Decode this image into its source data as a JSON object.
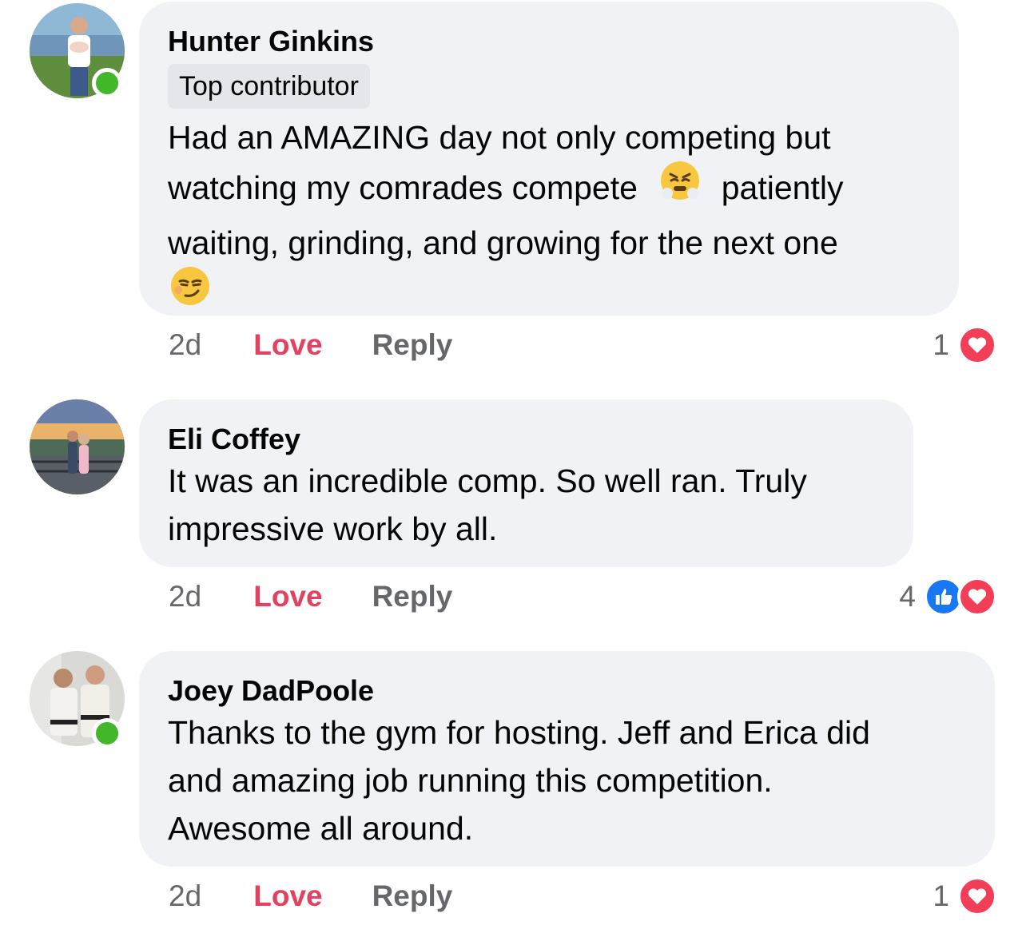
{
  "comments": [
    {
      "author": "Hunter Ginkins",
      "badge": "Top contributor",
      "text_lines": [
        "Had an AMAZING day not only competing but",
        "watching my comrades compete",
        "patiently",
        "waiting, grinding, and growing for the next one"
      ],
      "emojis": [
        "steam-from-nose-emoji",
        "smirking-face-emoji"
      ],
      "online": true,
      "time": "2d",
      "love_label": "Love",
      "reply_label": "Reply",
      "reaction_count": "1",
      "reactions": [
        "love"
      ]
    },
    {
      "author": "Eli Coffey",
      "text_lines": [
        "It was an incredible comp. So well ran. Truly",
        "impressive work by all."
      ],
      "online": false,
      "time": "2d",
      "love_label": "Love",
      "reply_label": "Reply",
      "reaction_count": "4",
      "reactions": [
        "like",
        "love"
      ]
    },
    {
      "author": "Joey DadPoole",
      "text_lines": [
        "Thanks to the gym for hosting. Jeff and Erica did",
        "and amazing job running this competition.",
        "Awesome all around."
      ],
      "online": true,
      "time": "2d",
      "love_label": "Love",
      "reply_label": "Reply",
      "reaction_count": "1",
      "reactions": [
        "love"
      ]
    }
  ],
  "colors": {
    "bubble": "#f0f2f5",
    "love": "#e4405f",
    "meta": "#65676b",
    "online": "#42b72a",
    "like": "#1877f2",
    "heart": "#f33e58"
  }
}
